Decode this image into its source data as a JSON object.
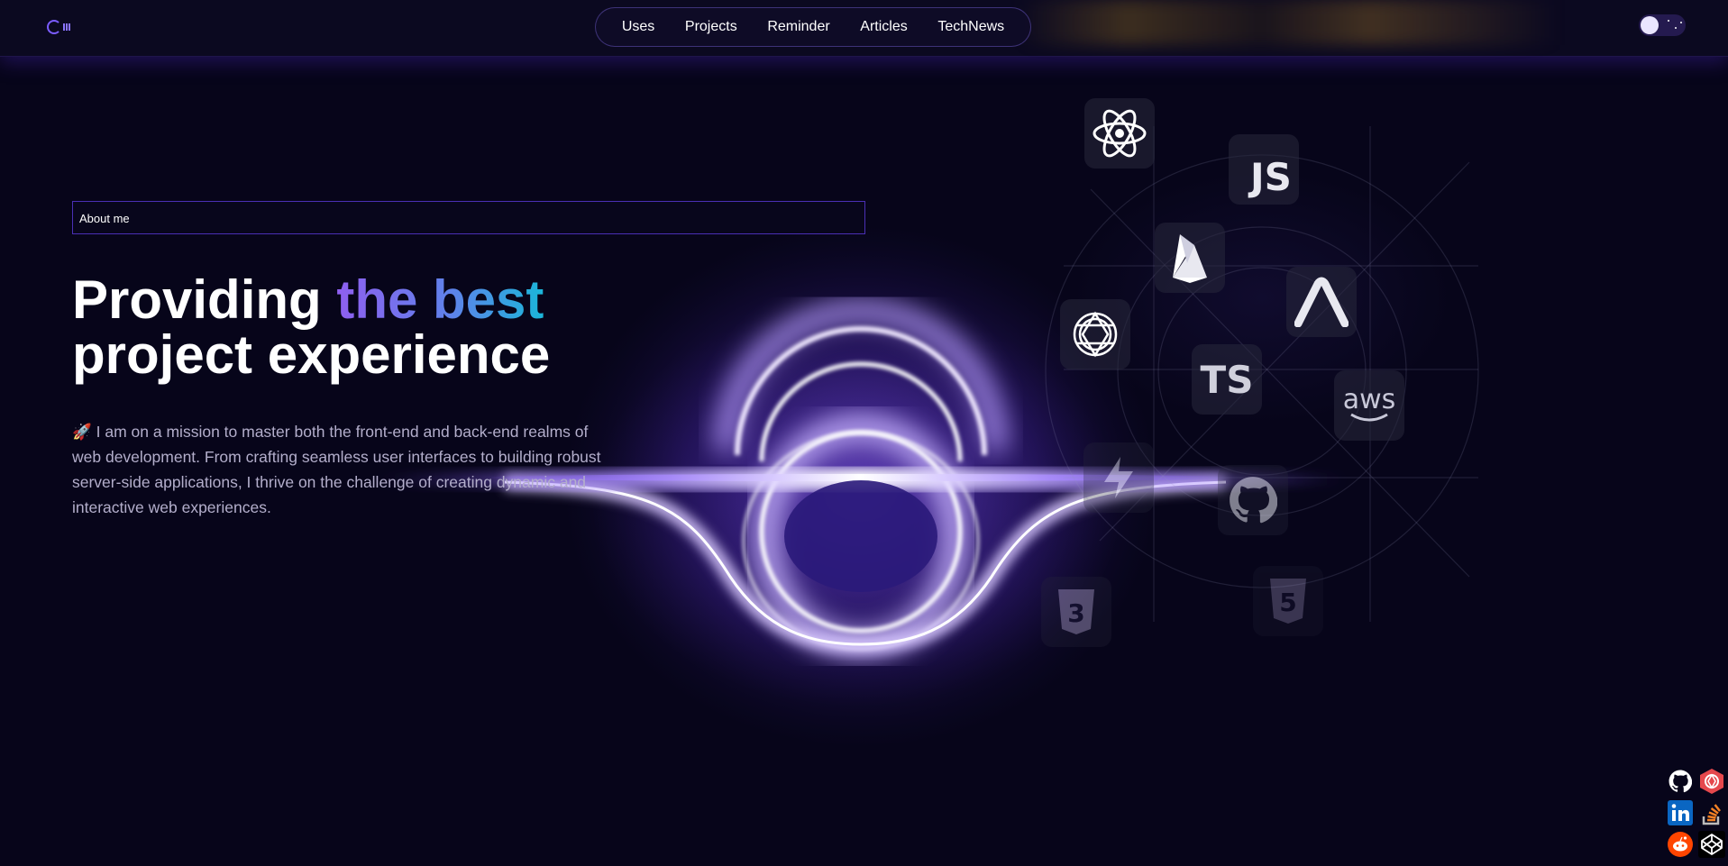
{
  "header": {
    "logo": "logo",
    "nav": [
      {
        "label": "Uses"
      },
      {
        "label": "Projects"
      },
      {
        "label": "Reminder"
      },
      {
        "label": "Articles"
      },
      {
        "label": "TechNews"
      }
    ],
    "theme_toggle": "dark"
  },
  "hero": {
    "about_label": "About me",
    "headline_part1": "Providing ",
    "headline_highlight": "the best",
    "headline_part2": "project experience",
    "description_emoji": "🚀",
    "description": " I am on a mission to master both the front-end and back-end realms of web development. From crafting seamless user interfaces to building robust server-side applications, I thrive on the challenge of creating dynamic and interactive web experiences."
  },
  "tech_icons": [
    {
      "name": "react-icon"
    },
    {
      "name": "javascript-icon",
      "text": "JS"
    },
    {
      "name": "firebase-icon"
    },
    {
      "name": "express-icon"
    },
    {
      "name": "openai-icon"
    },
    {
      "name": "typescript-icon",
      "text": "TS"
    },
    {
      "name": "aws-icon",
      "text": "aws"
    },
    {
      "name": "supabase-icon"
    },
    {
      "name": "github-icon"
    },
    {
      "name": "css3-icon"
    },
    {
      "name": "html5-icon"
    }
  ],
  "social_links": [
    {
      "name": "github-icon"
    },
    {
      "name": "openai-icon",
      "color": "#e5484d"
    },
    {
      "name": "linkedin-icon",
      "color": "#0a66c2"
    },
    {
      "name": "stackoverflow-icon",
      "color": "#f48024"
    },
    {
      "name": "reddit-icon",
      "color": "#ff4500"
    },
    {
      "name": "codepen-icon"
    }
  ],
  "colors": {
    "background": "#07051a",
    "accent": "#7b5cff",
    "gradient_start": "#8f5ff0",
    "gradient_end": "#1bb6d9"
  }
}
